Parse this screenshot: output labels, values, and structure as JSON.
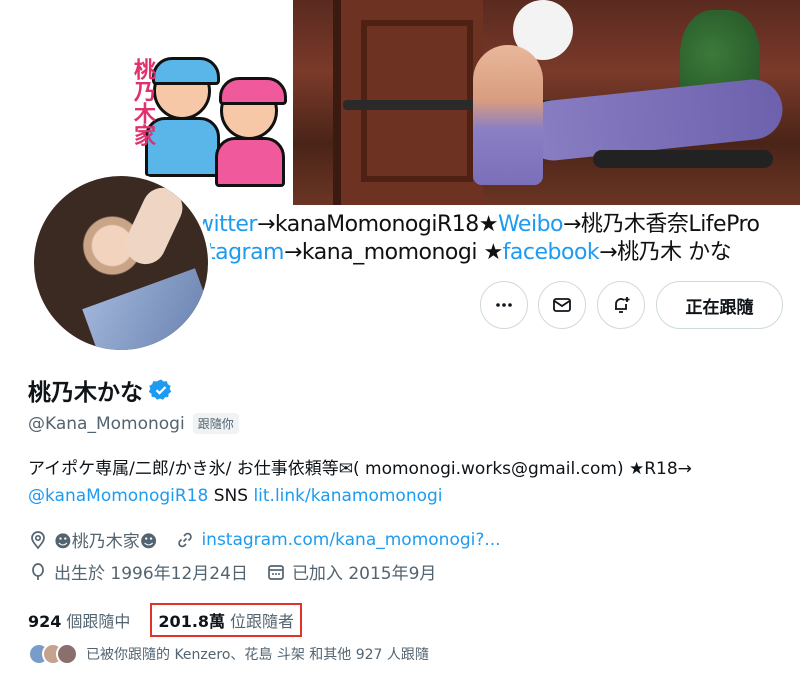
{
  "banner": {
    "vertical_text": "桃乃木家",
    "line1": {
      "twitter": "witter",
      "arrow1": "→kanaMomonogiR18★",
      "weibo": "Weibo",
      "arrow2": "→桃乃木香奈LifePro"
    },
    "line2": {
      "instagram": "stagram",
      "arrow1": "→kana_momonogi ★",
      "facebook": "facebook",
      "arrow2": "→桃乃木 かな"
    }
  },
  "actions": {
    "more_icon": "more-horizontal-icon",
    "message_icon": "envelope-icon",
    "notify_icon": "bell-plus-icon",
    "follow_label": "正在跟隨"
  },
  "profile": {
    "display_name": "桃乃木かな",
    "verified_icon": "verified-badge-icon",
    "handle": "@Kana_Momonogi",
    "follows_you": "跟隨你",
    "bio_line1": "アイポケ専属/二郎/かき氷/ お仕事依頼等✉( momonogi.works@gmail.com) ★R18→",
    "bio_mention": "@kanaMomonogiR18",
    "bio_sns": " SNS ",
    "bio_link": "lit.link/kanamomonogi",
    "location": "☻桃乃木家☻",
    "website": "instagram.com/kana_momonogi?...",
    "birthday": "出生於 1996年12月24日",
    "joined": "已加入 2015年9月"
  },
  "stats": {
    "following_count": "924",
    "following_label": "個跟隨中",
    "followers_count": "201.8萬",
    "followers_label": "位跟隨者"
  },
  "followed_by": {
    "text": "已被你跟隨的 Kenzero、花島 斗架 和其他 927 人跟隨"
  },
  "colors": {
    "accent": "#1d9bf0",
    "highlight_box": "#e0342b",
    "muted_text": "#536471"
  }
}
